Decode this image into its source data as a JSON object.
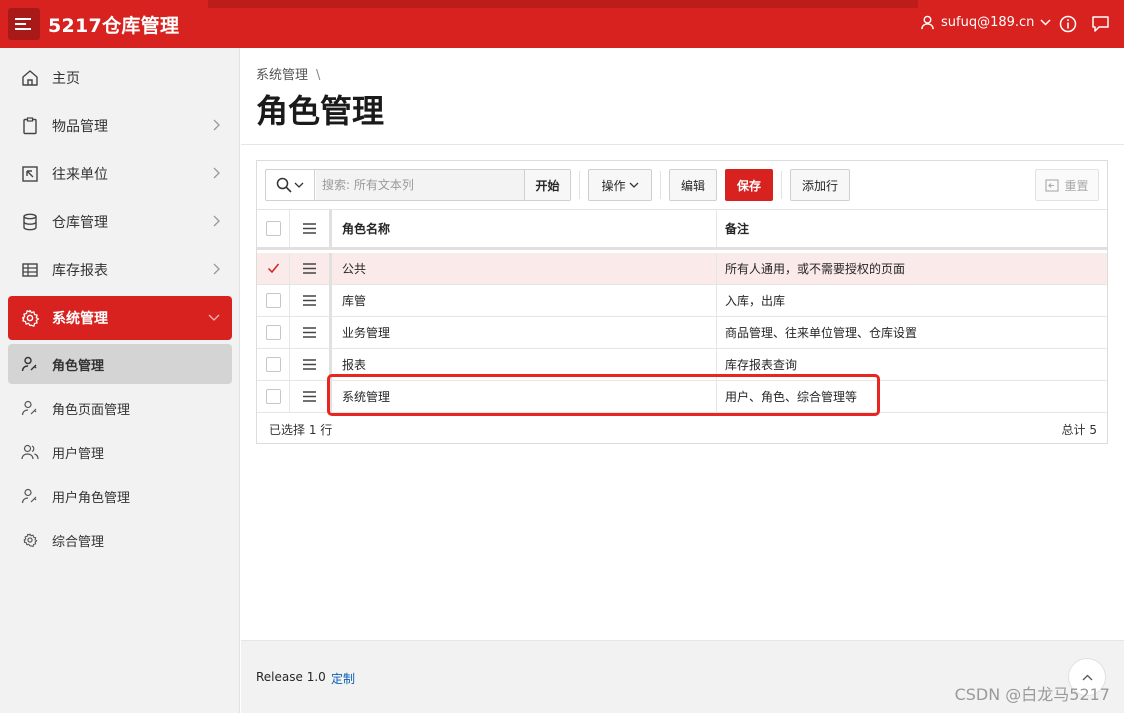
{
  "header": {
    "app_title": "5217仓库管理",
    "user": "sufuq@189.cn"
  },
  "sidebar": {
    "items": [
      {
        "label": "主页",
        "icon": "home-icon",
        "has_children": false
      },
      {
        "label": "物品管理",
        "icon": "clipboard-icon",
        "has_children": true
      },
      {
        "label": "往来单位",
        "icon": "arrow-box-icon",
        "has_children": true
      },
      {
        "label": "仓库管理",
        "icon": "database-icon",
        "has_children": true
      },
      {
        "label": "库存报表",
        "icon": "table-icon",
        "has_children": true
      },
      {
        "label": "系统管理",
        "icon": "gear-icon",
        "has_children": true,
        "active": true
      }
    ],
    "sub_items": [
      {
        "label": "角色管理",
        "icon": "user-key-icon",
        "current": true
      },
      {
        "label": "角色页面管理",
        "icon": "user-key-icon",
        "current": false
      },
      {
        "label": "用户管理",
        "icon": "users-icon",
        "current": false
      },
      {
        "label": "用户角色管理",
        "icon": "user-key-icon",
        "current": false
      },
      {
        "label": "综合管理",
        "icon": "gear-icon",
        "current": false
      }
    ]
  },
  "page": {
    "breadcrumb": "系统管理",
    "breadcrumb_sep": "\\",
    "title": "角色管理"
  },
  "toolbar": {
    "search_placeholder": "搜索: 所有文本列",
    "go_label": "开始",
    "actions_label": "操作",
    "edit_label": "编辑",
    "save_label": "保存",
    "add_row_label": "添加行",
    "reset_label": "重置"
  },
  "grid": {
    "columns": [
      "角色名称",
      "备注"
    ],
    "rows": [
      {
        "name": "公共",
        "note": "所有人通用，或不需要授权的页面",
        "selected": true
      },
      {
        "name": "库管",
        "note": "入库，出库",
        "selected": false
      },
      {
        "name": "业务管理",
        "note": "商品管理、往来单位管理、仓库设置",
        "selected": false
      },
      {
        "name": "报表",
        "note": "库存报表查询",
        "selected": false
      },
      {
        "name": "系统管理",
        "note": "用户、角色、综合管理等",
        "selected": false
      }
    ],
    "selection_text": "已选择 1 行",
    "total_text": "总计 5"
  },
  "footer": {
    "release": "Release 1.0",
    "customize": "定制"
  },
  "watermark": "CSDN @白龙马5217",
  "colors": {
    "brand": "#d7221f",
    "selected_row": "#fbeaea",
    "annotation": "#e8251f"
  }
}
